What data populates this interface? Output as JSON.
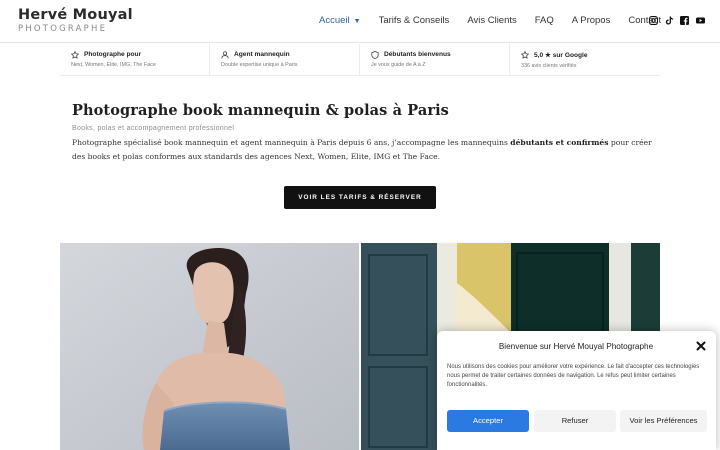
{
  "brand": {
    "name": "Hervé Mouyal",
    "tagline": "PHOTOGRAPHE"
  },
  "nav": {
    "items": [
      {
        "label": "Accueil",
        "active": true,
        "dropdown": true
      },
      {
        "label": "Tarifs & Conseils"
      },
      {
        "label": "Avis Clients"
      },
      {
        "label": "FAQ"
      },
      {
        "label": "A Propos"
      },
      {
        "label": "Contact"
      }
    ],
    "socials": [
      "instagram-icon",
      "tiktok-icon",
      "facebook-icon",
      "youtube-icon"
    ]
  },
  "features": [
    {
      "icon": "star-icon",
      "title": "Photographe pour",
      "subtitle": "Next, Women, Elite, IMG, The Face"
    },
    {
      "icon": "user-icon",
      "title": "Agent mannequin",
      "subtitle": "Double expertise unique à Paris"
    },
    {
      "icon": "shield-icon",
      "title": "Débutants bienvenus",
      "subtitle": "Je vous guide de A à Z"
    },
    {
      "icon": "star-icon",
      "title": "5,0 ★ sur Google",
      "subtitle": "336 avis clients vérifiés"
    }
  ],
  "intro": {
    "title": "Photographe book mannequin & polas à Paris",
    "subtitle": "Books, polas et accompagnement professionnel",
    "desc_part1": "Photographe spécialisé book mannequin et agent mannequin à Paris depuis 6 ans, j’accompagne les mannequins ",
    "desc_bold": "débutants et confirmés",
    "desc_part2": " pour créer des books et polas conformes aux standards des agences Next, Women, Elite, IMG et The Face."
  },
  "cta": {
    "label": "VOIR LES TARIFS & RÉSERVER"
  },
  "colors": {
    "accent": "#2f63a8",
    "cta_bg": "#111111",
    "accept_bg": "#2a7ae2"
  },
  "cookie": {
    "title": "Bienvenue sur Hervé Mouyal Photographe",
    "text": "Nous utilisons des cookies pour améliorer votre expérience. Le fait d'accepter ces technologies nous permet de traiter certaines données de navigation. Le refus peut limiter certaines fonctionnalités.",
    "accept": "Accepter",
    "refuse": "Refuser",
    "preferences": "Voir les Préférences"
  }
}
